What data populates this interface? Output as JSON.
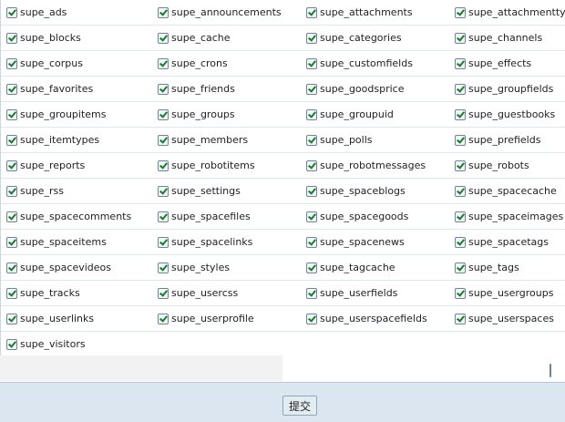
{
  "tables": [
    [
      "supe_ads",
      "supe_announcements",
      "supe_attachments",
      "supe_attachmenttypes"
    ],
    [
      "supe_blocks",
      "supe_cache",
      "supe_categories",
      "supe_channels"
    ],
    [
      "supe_corpus",
      "supe_crons",
      "supe_customfields",
      "supe_effects"
    ],
    [
      "supe_favorites",
      "supe_friends",
      "supe_goodsprice",
      "supe_groupfields"
    ],
    [
      "supe_groupitems",
      "supe_groups",
      "supe_groupuid",
      "supe_guestbooks"
    ],
    [
      "supe_itemtypes",
      "supe_members",
      "supe_polls",
      "supe_prefields"
    ],
    [
      "supe_reports",
      "supe_robotitems",
      "supe_robotmessages",
      "supe_robots"
    ],
    [
      "supe_rss",
      "supe_settings",
      "supe_spaceblogs",
      "supe_spacecache"
    ],
    [
      "supe_spacecomments",
      "supe_spacefiles",
      "supe_spacegoods",
      "supe_spaceimages"
    ],
    [
      "supe_spaceitems",
      "supe_spacelinks",
      "supe_spacenews",
      "supe_spacetags"
    ],
    [
      "supe_spacevideos",
      "supe_styles",
      "supe_tagcache",
      "supe_tags"
    ],
    [
      "supe_tracks",
      "supe_usercss",
      "supe_userfields",
      "supe_usergroups"
    ],
    [
      "supe_userlinks",
      "supe_userprofile",
      "supe_userspacefields",
      "supe_userspaces"
    ],
    [
      "supe_visitors"
    ]
  ],
  "submit_label": "提交",
  "colors": {
    "check": "#1a7a2a",
    "bar": "#dbe6f0"
  }
}
